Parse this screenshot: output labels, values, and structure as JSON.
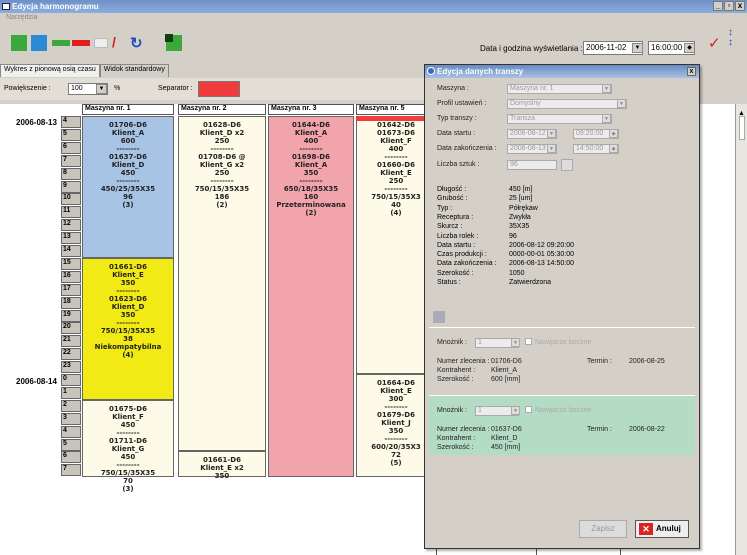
{
  "window": {
    "title": "Edycja harmonogramu",
    "controls": [
      "_",
      "▫",
      "x"
    ]
  },
  "menu": {
    "tools": "Narzędzia"
  },
  "toolbar": {
    "exec_label": "Data i godzina wyświetlania :",
    "exec_date": "2006-11-02",
    "exec_time": "16:00:00",
    "icons": [
      "add-icon",
      "add-blue-icon",
      "remove-icon",
      "remove-red-icon",
      "edit-icon",
      "pencil-icon",
      "refresh-icon",
      "split-icon",
      "clear-icon",
      "sort-icon"
    ]
  },
  "tabs": [
    {
      "label": "Wykres z pionową osią czasu"
    },
    {
      "label": "Widok standardowy"
    }
  ],
  "zoom": {
    "label": "Powiększenie :",
    "value": "100",
    "unit": "%",
    "separator_label": "Separator :",
    "separator_color": "#f03c3c"
  },
  "grid": {
    "columns": [
      {
        "name": "Maszyna nr. 1"
      },
      {
        "name": "Maszyna nr. 2"
      },
      {
        "name": "Maszyna nr. 3"
      },
      {
        "name": "Maszyna nr. 5"
      }
    ],
    "dates": [
      "2006-08-13",
      "2006-08-14"
    ],
    "hours": [
      "4",
      "5",
      "6",
      "7",
      "8",
      "9",
      "10",
      "11",
      "12",
      "13",
      "14",
      "15",
      "16",
      "17",
      "18",
      "19",
      "20",
      "21",
      "22",
      "23",
      "0",
      "1",
      "2",
      "3",
      "4",
      "5",
      "6",
      "7"
    ],
    "blocks": [
      {
        "col": 0,
        "row": 0,
        "rows": 11,
        "color": "#a8c4e4",
        "lines": [
          "01706-D6",
          "Klient_A",
          "600",
          "--------",
          "01637-D6",
          "Klient_D",
          "450",
          "--------",
          "450/25/35X35",
          "96",
          "(3)"
        ]
      },
      {
        "col": 0,
        "row": 11,
        "rows": 11,
        "color": "#f2ea14",
        "lines": [
          "01661-D6",
          "Klient_E",
          "350",
          "--------",
          "01623-D6",
          "Klient_D",
          "350",
          "--------",
          "750/15/35X35",
          "38",
          "Niekompatybilna",
          "(4)"
        ]
      },
      {
        "col": 0,
        "row": 22,
        "rows": 6,
        "color": "#fdfbe8",
        "lines": [
          "01675-D6",
          "Klient_F",
          "450",
          "--------",
          "01711-D6",
          "Klient_G",
          "450",
          "--------",
          "750/15/35X35",
          "70",
          "(3)"
        ]
      },
      {
        "col": 1,
        "row": 0,
        "rows": 26,
        "color": "#fdfbe8",
        "lines": [
          "01628-D6",
          "Klient_D x2",
          "250",
          "--------",
          "01708-D6 @",
          "Klient_G x2",
          "250",
          "--------",
          "750/15/35X35",
          "186",
          "(2)"
        ]
      },
      {
        "col": 1,
        "row": 26,
        "rows": 2,
        "color": "#fdfbe8",
        "lines": [
          "01661-D6",
          "Klient_E x2",
          "350"
        ]
      },
      {
        "col": 2,
        "row": 0,
        "rows": 28,
        "color": "#f2a4ac",
        "lines": [
          "01644-D6",
          "Klient_A",
          "400",
          "--------",
          "01698-D6",
          "Klient_A",
          "350",
          "--------",
          "650/18/35X35",
          "160",
          "Przeterminowana",
          "(2)"
        ]
      },
      {
        "col": 3,
        "row": 0,
        "rows": 20,
        "color": "#fdfbe8",
        "lines": [
          "01642-D6",
          "01673-D6",
          "Klient_F",
          "400",
          "--------",
          "01660-D6",
          "Klient_E",
          "250",
          "--------",
          "750/15/35X3",
          "40",
          "(4)"
        ]
      },
      {
        "col": 3,
        "row": 20,
        "rows": 8,
        "color": "#fdfbe8",
        "lines": [
          "01664-D6",
          "Klient_E",
          "300",
          "--------",
          "01679-D6",
          "Klient_J",
          "350",
          "--------",
          "600/20/35X3",
          "72",
          "(5)"
        ]
      }
    ]
  },
  "dialog": {
    "title": "Edycja danych transzy",
    "form": [
      {
        "label": "Maszyna :",
        "value": "Maszyna nr. 1"
      },
      {
        "label": "Profil ustawień :",
        "value": "Domyślny"
      },
      {
        "label": "Typ transzy :",
        "value": "Transza"
      },
      {
        "label": "Data startu :",
        "value": "2006-08-12",
        "time": "09:20:00"
      },
      {
        "label": "Data zakończenia :",
        "value": "2006-08-13",
        "time": "14:50:00"
      },
      {
        "label": "Liczba sztuk :",
        "value": "96"
      }
    ],
    "info": [
      {
        "label": "Długość :",
        "value": "450 [m]"
      },
      {
        "label": "Grubość :",
        "value": "25 [um]"
      },
      {
        "label": "Typ :",
        "value": "Półrękaw"
      },
      {
        "label": "Receptura :",
        "value": "Zwykła"
      },
      {
        "label": "Skurcz :",
        "value": "35X35"
      },
      {
        "label": "Liczba rolek :",
        "value": "96"
      },
      {
        "label": "Data startu :",
        "value": "2006-08-12 09:20:00"
      },
      {
        "label": "Czas produkcji :",
        "value": "0000-00-01 05:30:00"
      },
      {
        "label": "Data zakończenia :",
        "value": "2006-08-13 14:50:00"
      },
      {
        "label": "Szerokość :",
        "value": "1050"
      },
      {
        "label": "Status :",
        "value": "Zatwierdzona"
      }
    ],
    "orders": [
      {
        "mult_label": "Mnożnik :",
        "mult": "1",
        "side": "Nawijacze boczne",
        "order_label": "Numer zlecenia :",
        "order": "01706-D6",
        "term_label": "Termin :",
        "term": "2006-08-25",
        "client_label": "Kontrahent :",
        "client": "Klient_A",
        "width_label": "Szerokość :",
        "width": "600 [mm]",
        "bg": "#d4d0c8"
      },
      {
        "mult_label": "Mnożnik :",
        "mult": "1",
        "side": "Nawijacze boczne",
        "order_label": "Numer zlecenia :",
        "order": "01637-D6",
        "term_label": "Termin :",
        "term": "2006-08-22",
        "client_label": "Kontrahent :",
        "client": "Klient_D",
        "width_label": "Szerokość :",
        "width": "450 [mm]",
        "bg": "#b4dcc4"
      }
    ],
    "buttons": {
      "save": "Zapisz",
      "cancel": "Anuluj"
    }
  }
}
